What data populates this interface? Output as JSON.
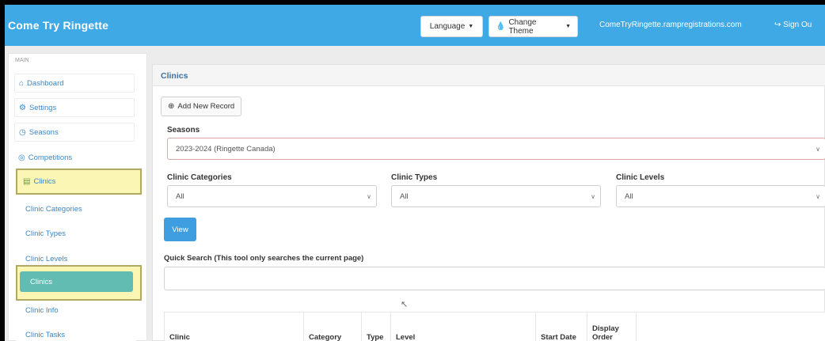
{
  "navbar": {
    "brand": "Come Try Ringette",
    "language_label": "Language",
    "theme_label": "Change Theme",
    "site_link": "ComeTryRingette.rampregistrations.com",
    "signout_label": "Sign Ou"
  },
  "sidebar": {
    "section_label": "MAIN",
    "items": [
      {
        "label": "Dashboard",
        "icon": "home-icon"
      },
      {
        "label": "Settings",
        "icon": "gear-icon"
      },
      {
        "label": "Seasons",
        "icon": "clock-icon"
      },
      {
        "label": "Competitions",
        "icon": "globe-icon"
      },
      {
        "label": "Clinics",
        "icon": "book-icon"
      }
    ],
    "sub_items": [
      "Clinic Categories",
      "Clinic Types",
      "Clinic Levels",
      "Clinics",
      "Clinic Info",
      "Clinic Tasks"
    ]
  },
  "panel": {
    "title": "Clinics",
    "add_label": "Add New Record",
    "seasons_label": "Seasons",
    "seasons_value": "2023-2024 (Ringette Canada)",
    "categories_label": "Clinic Categories",
    "categories_value": "All",
    "types_label": "Clinic Types",
    "types_value": "All",
    "levels_label": "Clinic Levels",
    "levels_value": "All",
    "view_label": "View",
    "quick_search_label": "Quick Search (This tool only searches the current page)",
    "quick_search_value": ""
  },
  "table": {
    "headers": [
      "Clinic",
      "Category",
      "Type",
      "Level",
      "Start Date",
      "Display Order",
      ""
    ]
  },
  "colors": {
    "navbar": "#3fa9e6",
    "highlight": "#fbf6b3",
    "active_item": "#62bcb1",
    "view_button": "#3f9ee0"
  }
}
